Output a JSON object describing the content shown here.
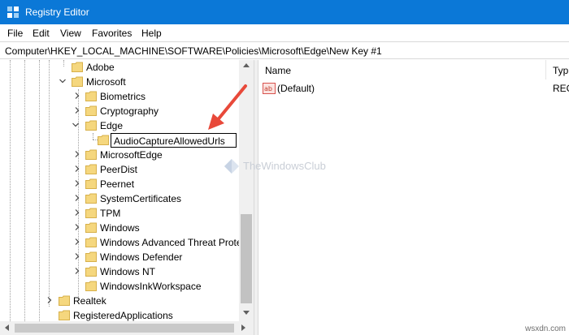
{
  "window": {
    "title": "Registry Editor"
  },
  "menu": [
    "File",
    "Edit",
    "View",
    "Favorites",
    "Help"
  ],
  "address": "Computer\\HKEY_LOCAL_MACHINE\\SOFTWARE\\Policies\\Microsoft\\Edge\\New Key #1",
  "tree": {
    "items": [
      {
        "label": "Adobe",
        "expanded": false
      },
      {
        "label": "Microsoft",
        "expanded": true
      },
      {
        "label": "Biometrics",
        "expanded": false
      },
      {
        "label": "Cryptography",
        "expanded": false
      },
      {
        "label": "Edge",
        "expanded": true
      },
      {
        "label": "AudioCaptureAllowedUrls",
        "editing": true
      },
      {
        "label": "MicrosoftEdge",
        "expanded": false
      },
      {
        "label": "PeerDist",
        "expanded": false
      },
      {
        "label": "Peernet",
        "expanded": false
      },
      {
        "label": "SystemCertificates",
        "expanded": false
      },
      {
        "label": "TPM",
        "expanded": false
      },
      {
        "label": "Windows",
        "expanded": false
      },
      {
        "label": "Windows Advanced Threat Prote",
        "expanded": false
      },
      {
        "label": "Windows Defender",
        "expanded": false
      },
      {
        "label": "Windows NT",
        "expanded": false
      },
      {
        "label": "WindowsInkWorkspace",
        "expanded": false
      },
      {
        "label": "Realtek",
        "expanded": false
      },
      {
        "label": "RegisteredApplications",
        "expanded": false
      }
    ],
    "rename_value": "AudioCaptureAllowedUrls"
  },
  "values_pane": {
    "columns": {
      "name": "Name",
      "type": "Typ"
    },
    "rows": [
      {
        "name": "(Default)",
        "type": "REG",
        "icon": "string-value-icon"
      }
    ]
  },
  "watermark": "TheWindowsClub",
  "corner_watermark": "wsxdn.com",
  "colors": {
    "titlebar": "#0b78d7",
    "folder": "#f5d77e",
    "arrow": "#e8493a"
  }
}
